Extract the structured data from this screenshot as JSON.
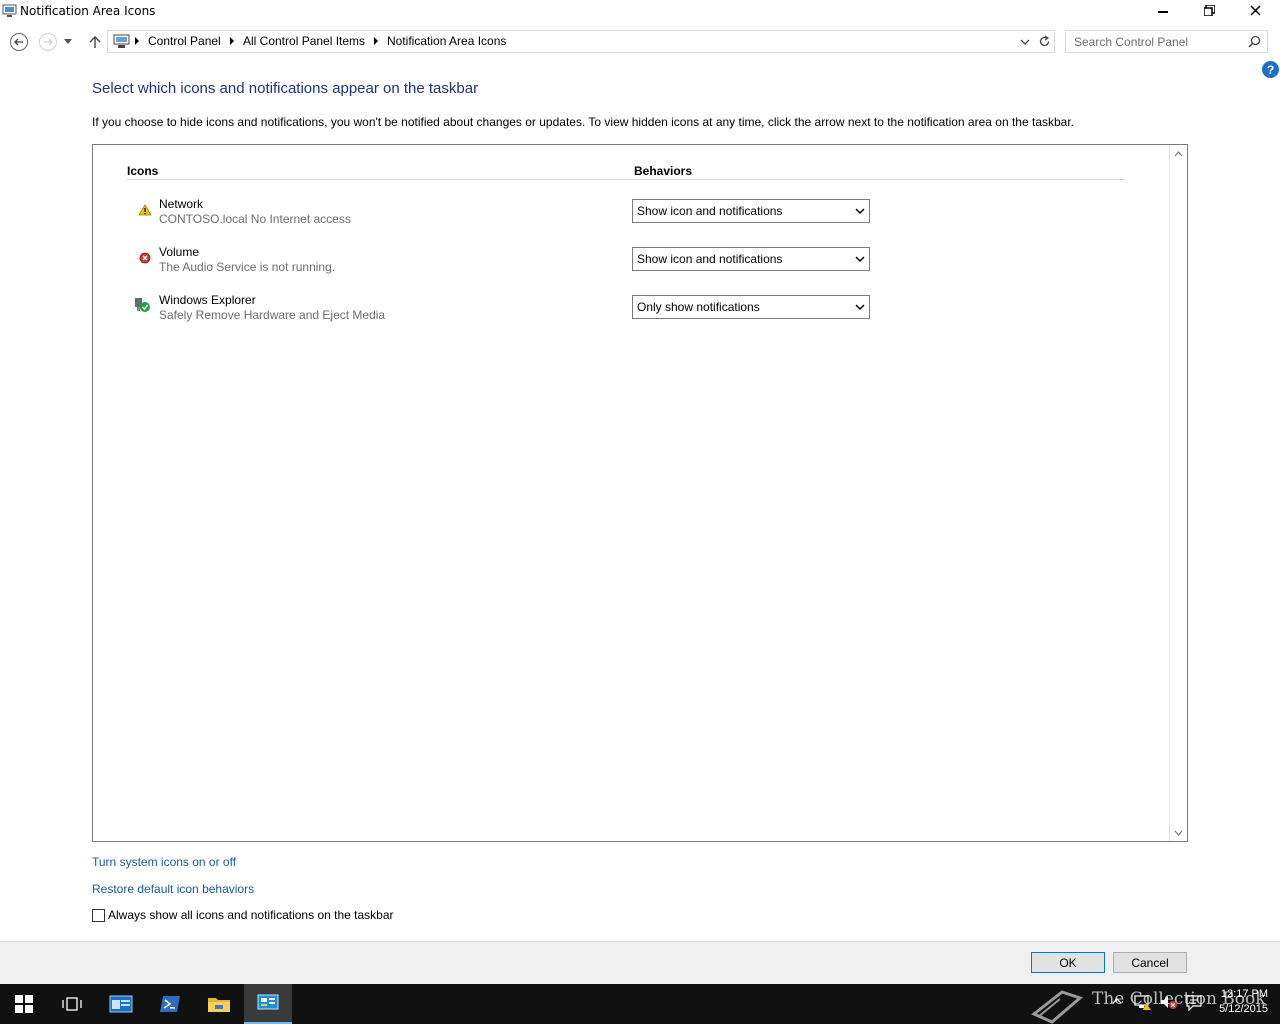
{
  "window": {
    "title": "Notification Area Icons"
  },
  "address": {
    "breadcrumbs": [
      "Control Panel",
      "All Control Panel Items",
      "Notification Area Icons"
    ],
    "search_placeholder": "Search Control Panel"
  },
  "content": {
    "heading": "Select which icons and notifications appear on the taskbar",
    "intro": "If you choose to hide icons and notifications, you won't be notified about changes or updates. To view hidden icons at any time, click the arrow next to the notification area on the taskbar.",
    "col_icons": "Icons",
    "col_behaviors": "Behaviors",
    "rows": [
      {
        "name": "Network",
        "desc": "CONTOSO.local No Internet access",
        "behavior": "Show icon and notifications",
        "icon": "network-warning-icon"
      },
      {
        "name": "Volume",
        "desc": "The Audio Service is not running.",
        "behavior": "Show icon and notifications",
        "icon": "volume-error-icon"
      },
      {
        "name": "Windows Explorer",
        "desc": "Safely Remove Hardware and Eject Media",
        "behavior": "Only show notifications",
        "icon": "safely-remove-hardware-icon"
      }
    ],
    "link_system_icons": "Turn system icons on or off",
    "link_restore": "Restore default icon behaviors",
    "checkbox_label": "Always show all icons and notifications on the taskbar"
  },
  "buttons": {
    "ok": "OK",
    "cancel": "Cancel"
  },
  "taskbar": {
    "time": "12:17 PM",
    "date": "5/12/2015",
    "watermark": "The Collection Book"
  },
  "colors": {
    "heading": "#1e3287",
    "link": "#1a5aa6",
    "taskbar": "#111111",
    "accent": "#0078d7"
  }
}
